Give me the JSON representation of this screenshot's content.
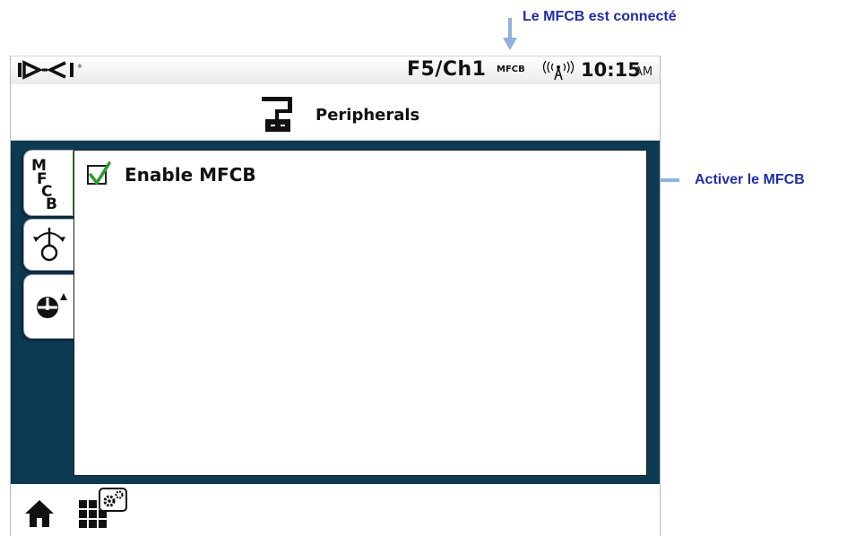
{
  "annotations": {
    "connected": "Le MFCB est connecté",
    "enable": "Activer le MFCB"
  },
  "statusbar": {
    "logo": "DCI",
    "channel": "F5/Ch1",
    "peripheral_status": "MFCB",
    "time": "10:15",
    "ampm": "AM",
    "signal_icon": "antenna-signal-icon"
  },
  "header": {
    "title": "Peripherals",
    "icon": "peripheral-device-icon"
  },
  "tabs": [
    {
      "name": "MFCB",
      "icon": "mfcb-tab-icon",
      "selected": true
    },
    {
      "name": "pitch",
      "icon": "pitch-calibration-icon",
      "selected": false
    },
    {
      "name": "dial",
      "icon": "dial-settings-icon",
      "selected": false
    }
  ],
  "panel": {
    "checkbox_label": "Enable MFCB",
    "checked": true
  },
  "bottom": {
    "home_icon": "home-icon",
    "settings_icon": "settings-grid-icon"
  },
  "colors": {
    "annotation": "#1f2dae",
    "arrow": "#8fb3de",
    "content_bg": "#0c3a52",
    "selected_tab_accent": "#3aa238",
    "check": "#2e9a2e"
  }
}
